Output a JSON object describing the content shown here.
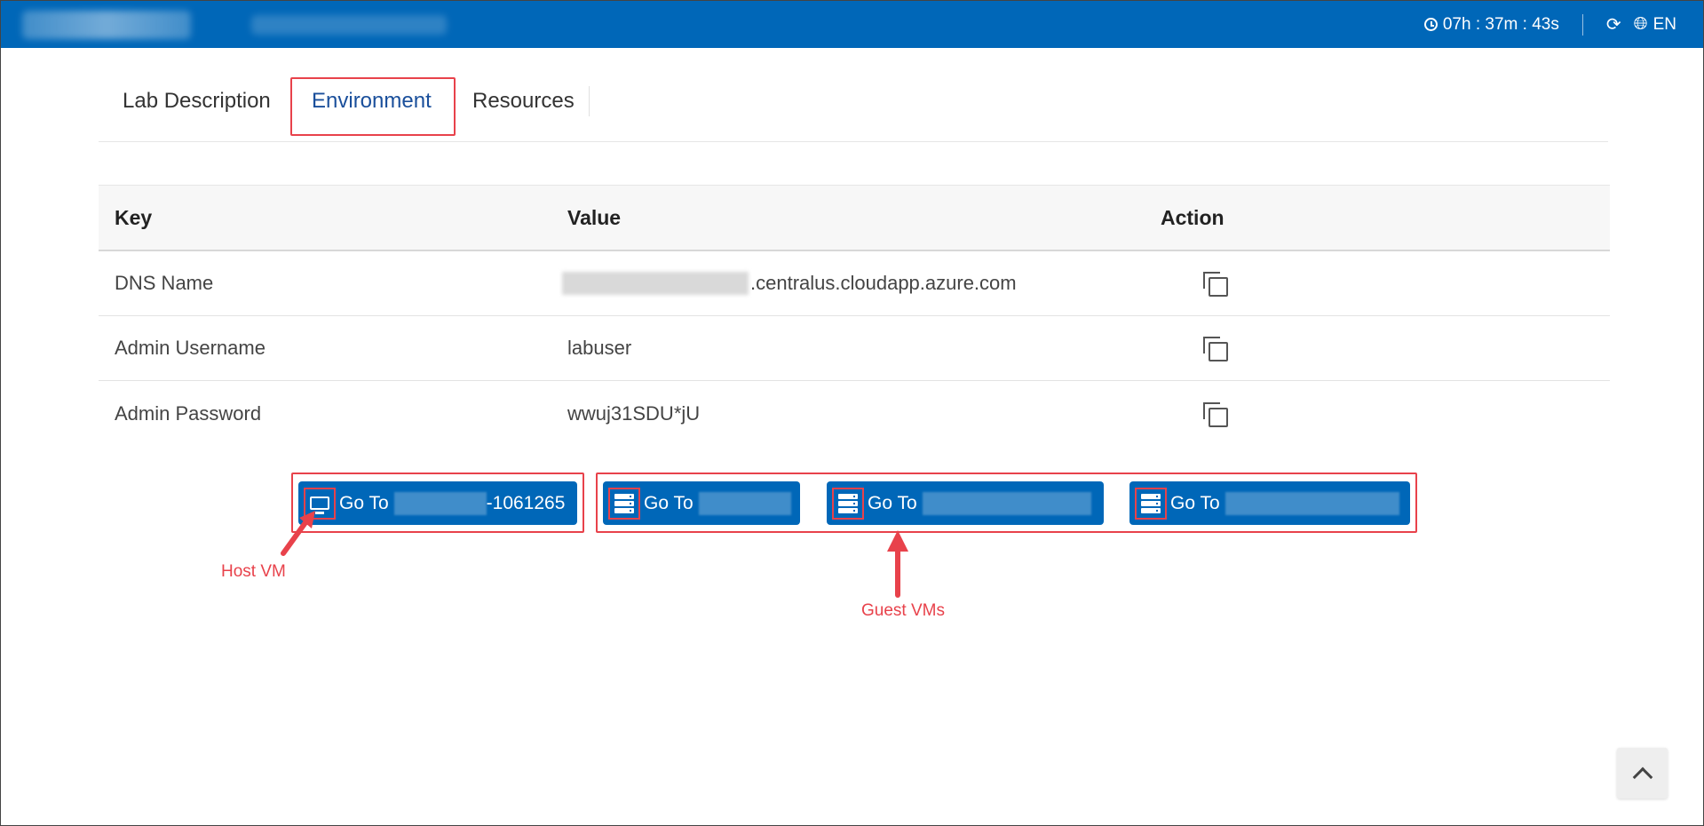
{
  "topbar": {
    "timer": "07h : 37m : 43s",
    "refresh_icon": "refresh-icon",
    "language": "EN",
    "globe_icon": "globe-icon",
    "clock_icon": "clock-icon"
  },
  "tabs": [
    {
      "label": "Lab Description"
    },
    {
      "label": "Environment",
      "active": true
    },
    {
      "label": "Resources"
    }
  ],
  "table": {
    "headers": {
      "key": "Key",
      "value": "Value",
      "action": "Action"
    },
    "rows": [
      {
        "key": "DNS Name",
        "value": ".centralus.cloudapp.azure.com"
      },
      {
        "key": "Admin Username",
        "value": "labuser"
      },
      {
        "key": "Admin Password",
        "value": "wwuj31SDU*jU"
      }
    ]
  },
  "vm_buttons": [
    {
      "prefix": "Go To",
      "suffix": "-1061265",
      "icon": "monitor-icon"
    },
    {
      "prefix": "Go To",
      "suffix": "",
      "icon": "server-icon"
    },
    {
      "prefix": "Go To",
      "suffix": "",
      "icon": "server-icon"
    },
    {
      "prefix": "Go To",
      "suffix": "",
      "icon": "server-icon"
    }
  ],
  "annotations": {
    "host": "Host VM",
    "guest": "Guest VMs"
  },
  "colors": {
    "brand": "#0067b8",
    "highlight": "#e8424b",
    "active_tab": "#1a4f9b"
  }
}
